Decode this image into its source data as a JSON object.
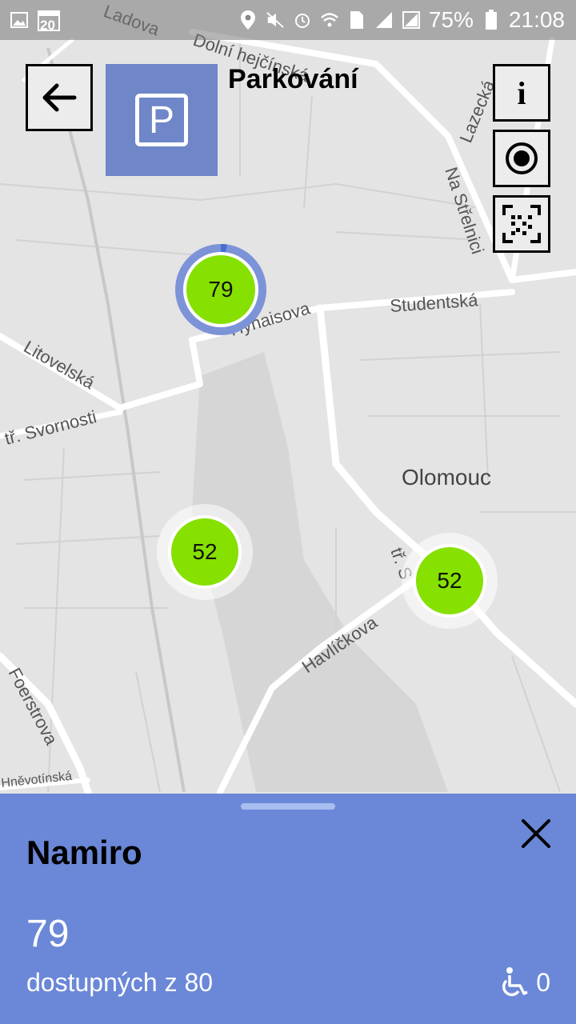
{
  "status_bar": {
    "battery": "75%",
    "time": "21:08",
    "calendar_day": "20"
  },
  "header": {
    "title": "Parkování",
    "parking_logo_letter": "P",
    "info_label": "i"
  },
  "map": {
    "street_labels": [
      "Ladova",
      "Dolní hejčínská",
      "Lazecká",
      "Na Střelnici",
      "Studentská",
      "Hynaisova",
      "Litovelská",
      "tř. Svornosti",
      "Olomouc",
      "tř. S",
      "Havlíčkova",
      "Foerstrova",
      "Hněvotínská"
    ],
    "clusters": [
      {
        "count": "79"
      },
      {
        "count": "52"
      },
      {
        "count": "52"
      }
    ]
  },
  "sheet": {
    "title": "Namiro",
    "available_count": "79",
    "available_text": "dostupných z 80",
    "wheelchair_count": "0"
  },
  "colors": {
    "accent": "#6b87d7",
    "logo": "#6f86c8",
    "cluster": "#86e000"
  }
}
